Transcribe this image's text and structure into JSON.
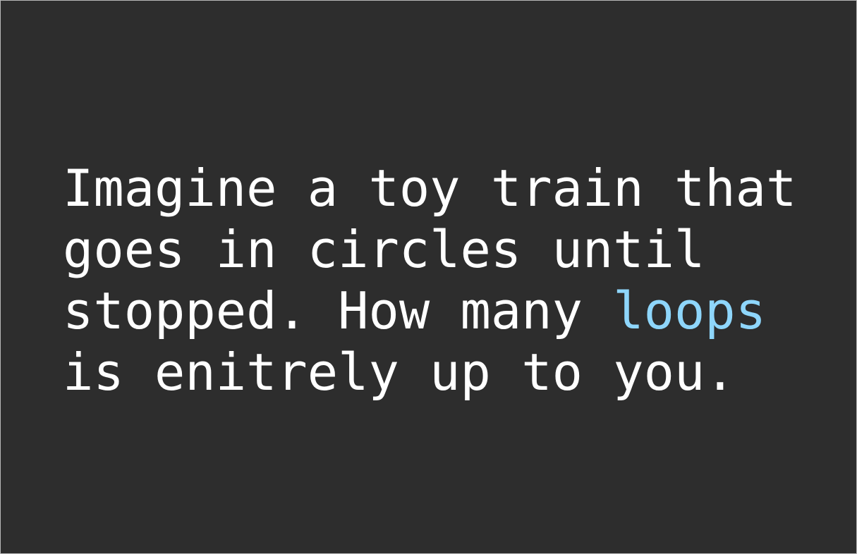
{
  "slide": {
    "line1": "Imagine a toy train that",
    "line2": "goes in circles until",
    "line3_before": "stopped. How many ",
    "line3_highlight": "loops",
    "line4": "is enitrely up to you."
  },
  "colors": {
    "background": "#2d2d2d",
    "text": "#ffffff",
    "highlight": "#8ed6fb"
  }
}
